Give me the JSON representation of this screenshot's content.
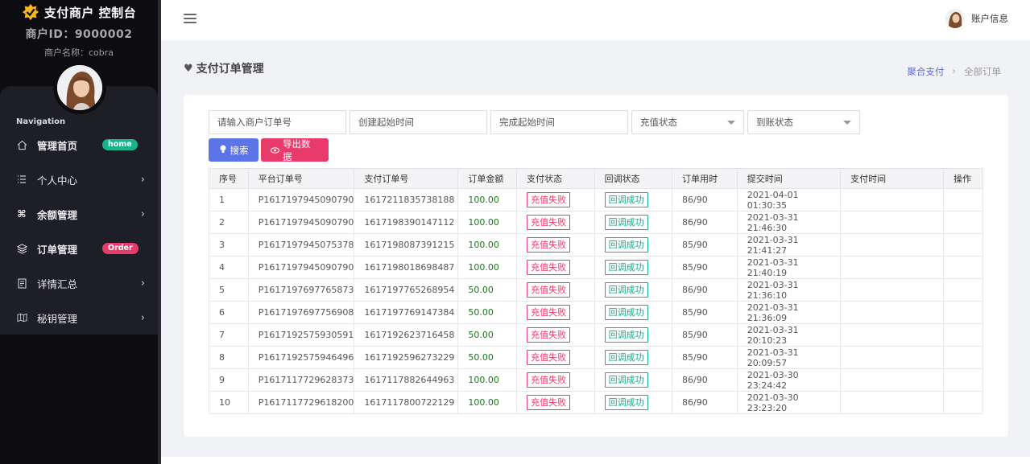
{
  "sidebar": {
    "brand_title": "支付商户 控制台",
    "merchant_id": "商户ID：9000002",
    "merchant_name": "商户名称：cobra",
    "nav_heading": "Navigation",
    "items": [
      {
        "label": "管理首页",
        "icon": "home-icon",
        "badge": "home"
      },
      {
        "label": "个人中心",
        "icon": "list-icon",
        "chevron": true
      },
      {
        "label": "余额管理",
        "icon": "command-icon",
        "chevron": true
      },
      {
        "label": "订单管理",
        "icon": "layers-icon",
        "badge": "Order"
      },
      {
        "label": "详情汇总",
        "icon": "document-icon",
        "chevron": true
      },
      {
        "label": "秘钥管理",
        "icon": "map-icon",
        "chevron": true
      }
    ]
  },
  "header": {
    "account_label": "账户信息"
  },
  "page": {
    "title": "支付订单管理",
    "breadcrumb": {
      "parent": "聚合支付",
      "sep": "›",
      "current": "全部订单"
    }
  },
  "filters": {
    "merchant_order_placeholder": "请输入商户订单号",
    "create_start_placeholder": "创建起始时间",
    "complete_start_placeholder": "完成起始时间",
    "recharge_status": "充值状态",
    "arrival_status": "到账状态",
    "search_label": "搜索",
    "export_label": "导出数据"
  },
  "table": {
    "headers": [
      "序号",
      "平台订单号",
      "支付订单号",
      "订单金额",
      "支付状态",
      "回调状态",
      "订单用时",
      "提交时间",
      "支付时间",
      "操作"
    ],
    "rows": [
      [
        "1",
        "P1617197945090790",
        "1617211835738188",
        "100.00",
        "充值失败",
        "回调成功",
        "86/90",
        "2021-04-01 01:30:35"
      ],
      [
        "2",
        "P1617197945090790",
        "1617198390147112",
        "100.00",
        "充值失败",
        "回调成功",
        "86/90",
        "2021-03-31 21:46:30"
      ],
      [
        "3",
        "P1617197945075378",
        "1617198087391215",
        "100.00",
        "充值失败",
        "回调成功",
        "85/90",
        "2021-03-31 21:41:27"
      ],
      [
        "4",
        "P1617197945090790",
        "1617198018698487",
        "100.00",
        "充值失败",
        "回调成功",
        "85/90",
        "2021-03-31 21:40:19"
      ],
      [
        "5",
        "P1617197697765873",
        "1617197765268954",
        "50.00",
        "充值失败",
        "回调成功",
        "86/90",
        "2021-03-31 21:36:10"
      ],
      [
        "6",
        "P1617197697756908",
        "1617197769147384",
        "50.00",
        "充值失败",
        "回调成功",
        "85/90",
        "2021-03-31 21:36:09"
      ],
      [
        "7",
        "P1617192575930591",
        "1617192623716458",
        "50.00",
        "充值失败",
        "回调成功",
        "85/90",
        "2021-03-31 20:10:23"
      ],
      [
        "8",
        "P1617192575946496",
        "1617192596273229",
        "50.00",
        "充值失败",
        "回调成功",
        "85/90",
        "2021-03-31 20:09:57"
      ],
      [
        "9",
        "P1617117729628373",
        "1617117882644963",
        "100.00",
        "充值失败",
        "回调成功",
        "86/90",
        "2021-03-30 23:24:42"
      ],
      [
        "10",
        "P1617117729618200",
        "1617117800722129",
        "100.00",
        "充值失败",
        "回调成功",
        "86/90",
        "2021-03-30 23:23:20"
      ]
    ]
  },
  "colors": {
    "sidebar_bg": "#0d0d11",
    "accent_blue": "#5b74e8",
    "accent_pink": "#e83b6b",
    "success_green": "#18b38a"
  }
}
